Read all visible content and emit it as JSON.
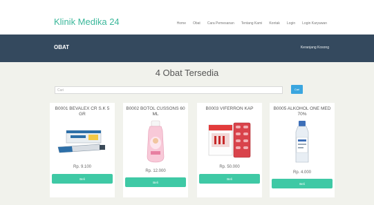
{
  "header": {
    "brand": "Klinik Medika 24",
    "nav": [
      "Home",
      "Obat",
      "Cara Pemesanan",
      "Tentang Kami",
      "Kontak",
      "Login",
      "Login Karyawan"
    ]
  },
  "titlebar": {
    "heading": "OBAT",
    "cart_label": "Keranjang Kosong"
  },
  "main": {
    "count_title": "4 Obat Tersedia",
    "search": {
      "placeholder": "Cari",
      "button_label": "Cari"
    },
    "products": [
      {
        "name": "B0001 BEVALEX CR S.K 5 GR",
        "price": "Rp. 9.100",
        "button_label": "Beli",
        "icon": "ointment-tube-icon"
      },
      {
        "name": "B0002 BOTOL CUSSONS 60 ML",
        "price": "Rp. 12.000",
        "button_label": "Beli",
        "icon": "baby-bottle-icon"
      },
      {
        "name": "B0003 VIFERRON KAP",
        "price": "Rp. 50.000",
        "button_label": "Beli",
        "icon": "capsule-pack-icon"
      },
      {
        "name": "B0005 ALKOHOL ONE MED 70%",
        "price": "Rp. 4.000",
        "button_label": "Beli",
        "icon": "alcohol-bottle-icon"
      }
    ]
  },
  "colors": {
    "brand": "#3ab79a",
    "titlebar": "#34495e",
    "buy_button": "#3fc9a5",
    "search_button": "#3aa6df"
  }
}
